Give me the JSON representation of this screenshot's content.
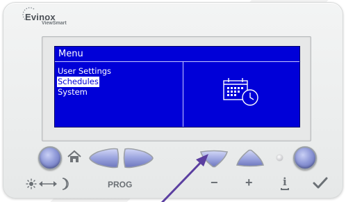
{
  "device": {
    "brand": "Evinox",
    "sub_brand": "ViewSmart"
  },
  "screen": {
    "title": "Menu",
    "menu_items": [
      {
        "label": "User Settings",
        "selected": false
      },
      {
        "label": "Schedules",
        "selected": true
      },
      {
        "label": "System",
        "selected": false
      }
    ],
    "preview_icon": "calendar-clock-icon"
  },
  "controls": {
    "prog_label": "PROG",
    "minus_label": "−",
    "plus_label": "+",
    "info_label": "i",
    "sun_icon": "sun-icon",
    "arrows_icon": "double-arrow-icon",
    "moon_icon": "moon-icon",
    "home_icon": "home-icon",
    "check_icon": "checkmark-icon"
  },
  "colors": {
    "lcd_background": "#0000d8",
    "button_blue": "#8f99d8",
    "cursor": "#5b3fa0"
  }
}
